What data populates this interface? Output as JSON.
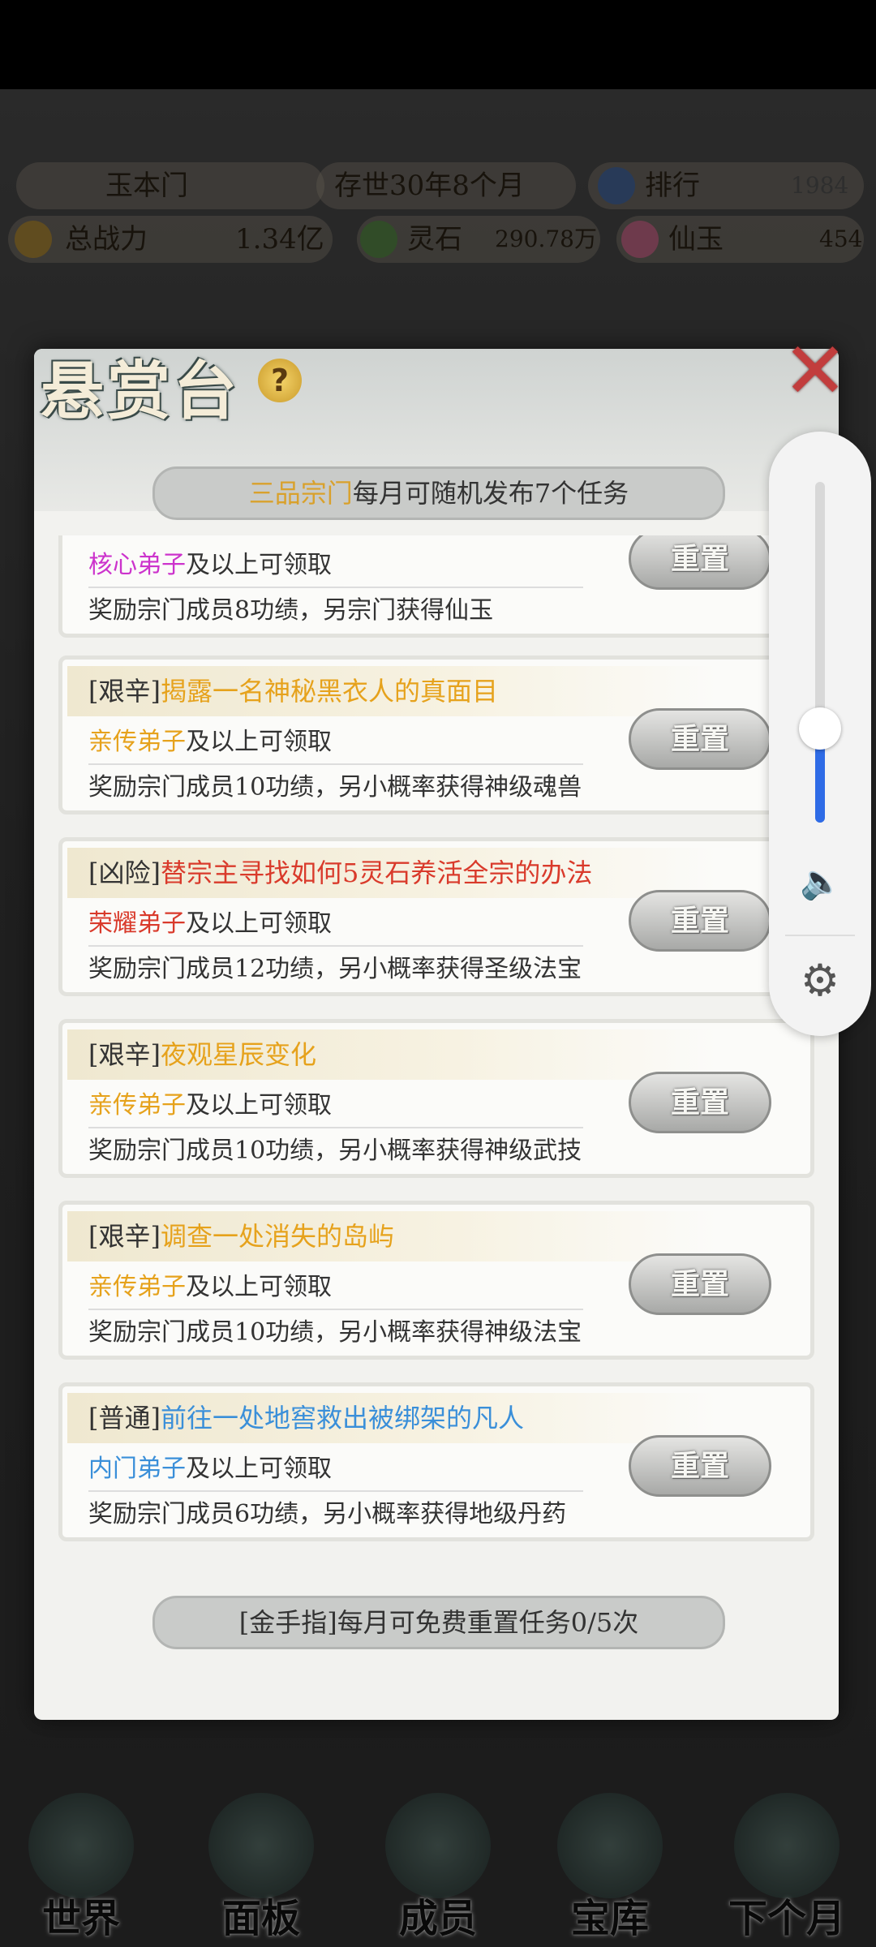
{
  "hud": {
    "sect_name": "玉本门",
    "existence": "存世30年8个月",
    "rank_label": "排行",
    "rank_value": "1984",
    "power_label": "总战力",
    "power_value": "1.34亿",
    "spirit_stone_label": "灵石",
    "spirit_stone_value": "290.78万",
    "jade_label": "仙玉",
    "jade_value": "454"
  },
  "modal": {
    "title": "悬赏台",
    "help_symbol": "?",
    "close_symbol": "✕",
    "banner_highlight": "三品宗门",
    "banner_text": "每月可随机发布7个任务",
    "footer_text": "[金手指]每月可免费重置任务0/5次"
  },
  "tasks": [
    {
      "tag": "",
      "title": "",
      "title_color": "#333333",
      "req_rank": "核心弟子",
      "req_color": "#cc33cc",
      "req_suffix": "及以上可领取",
      "reward": "奖励宗门成员8功绩，另宗门获得仙玉",
      "button": "重置"
    },
    {
      "tag": "[艰辛]",
      "title": "揭露一名神秘黑衣人的真面目",
      "title_color": "#e6a21c",
      "req_rank": "亲传弟子",
      "req_color": "#e6a21c",
      "req_suffix": "及以上可领取",
      "reward": "奖励宗门成员10功绩，另小概率获得神级魂兽",
      "button": "重置"
    },
    {
      "tag": "[凶险]",
      "title": "替宗主寻找如何5灵石养活全宗的办法",
      "title_color": "#d93a2b",
      "req_rank": "荣耀弟子",
      "req_color": "#d93a2b",
      "req_suffix": "及以上可领取",
      "reward": "奖励宗门成员12功绩，另小概率获得圣级法宝",
      "button": "重置"
    },
    {
      "tag": "[艰辛]",
      "title": "夜观星辰变化",
      "title_color": "#e6a21c",
      "req_rank": "亲传弟子",
      "req_color": "#e6a21c",
      "req_suffix": "及以上可领取",
      "reward": "奖励宗门成员10功绩，另小概率获得神级武技",
      "button": "重置"
    },
    {
      "tag": "[艰辛]",
      "title": "调查一处消失的岛屿",
      "title_color": "#e6a21c",
      "req_rank": "亲传弟子",
      "req_color": "#e6a21c",
      "req_suffix": "及以上可领取",
      "reward": "奖励宗门成员10功绩，另小概率获得神级法宝",
      "button": "重置"
    },
    {
      "tag": "[普通]",
      "title": "前往一处地窖救出被绑架的凡人",
      "title_color": "#3a8fd9",
      "req_rank": "内门弟子",
      "req_color": "#3a8fd9",
      "req_suffix": "及以上可领取",
      "reward": "奖励宗门成员6功绩，另小概率获得地级丹药",
      "button": "重置"
    }
  ],
  "nav": [
    "世界",
    "面板",
    "成员",
    "宝库",
    "下个月"
  ],
  "volume": {
    "level_fraction": 0.28,
    "speaker_icon": "speaker-icon",
    "settings_icon": "gear-icon"
  }
}
